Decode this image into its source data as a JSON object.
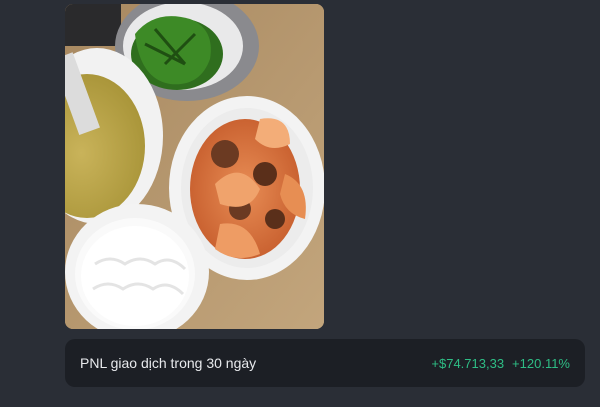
{
  "photo": {
    "alt_icon": "food-photo-icon"
  },
  "pnl": {
    "label": "PNL giao dịch trong 30 ngày",
    "amount": "+$74.713,33",
    "percent": "+120.11%",
    "value_color": "#2ebd85"
  }
}
